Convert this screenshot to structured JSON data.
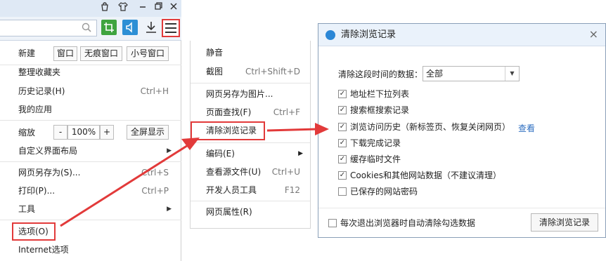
{
  "titlebar": {
    "icons": [
      "bag-icon",
      "shirt-icon",
      "minimize-icon",
      "restore-icon",
      "close-icon"
    ]
  },
  "toolbar": {
    "menu_icon": "hamburger-menu-icon"
  },
  "main_menu": {
    "new_label": "新建",
    "new_buttons": [
      "窗口",
      "无痕窗口",
      "小号窗口"
    ],
    "items_a": [
      {
        "label": "整理收藏夹",
        "shortcut": ""
      },
      {
        "label": "历史记录(H)",
        "shortcut": "Ctrl+H"
      },
      {
        "label": "我的应用",
        "shortcut": ""
      }
    ],
    "zoom_label": "缩放",
    "zoom_minus": "-",
    "zoom_value": "100%",
    "zoom_plus": "+",
    "fullscreen_label": "全屏显示",
    "custom_layout": "自定义界面布局",
    "items_b": [
      {
        "label": "网页另存为(S)...",
        "shortcut": "Ctrl+S"
      },
      {
        "label": "打印(P)...",
        "shortcut": "Ctrl+P"
      },
      {
        "label": "工具",
        "shortcut": ""
      }
    ],
    "options_label": "选项(O)",
    "internet_options": "Internet选项"
  },
  "sub_menu": {
    "mute": "静音",
    "screenshot": "截图",
    "screenshot_sc": "Ctrl+Shift+D",
    "save_as_image": "网页另存为图片...",
    "find": "页面查找(F)",
    "find_sc": "Ctrl+F",
    "clear_history": "清除浏览记录",
    "encoding": "编码(E)",
    "view_source": "查看源文件(U)",
    "view_source_sc": "Ctrl+U",
    "dev_tools": "开发人员工具",
    "dev_tools_sc": "F12",
    "page_props": "网页属性(R)"
  },
  "dialog": {
    "title": "清除浏览记录",
    "close": "×",
    "range_label": "清除这段时间的数据：",
    "range_value": "全部",
    "options": [
      {
        "label": "地址栏下拉列表",
        "checked": true
      },
      {
        "label": "搜索框搜索记录",
        "checked": true
      },
      {
        "label": "浏览访问历史（新标签页、恢复关闭网页）",
        "checked": true
      },
      {
        "label": "下载完成记录",
        "checked": true
      },
      {
        "label": "缓存临时文件",
        "checked": true
      },
      {
        "label": "Cookies和其他网站数据（不建议清理）",
        "checked": true
      },
      {
        "label": "已保存的网站密码",
        "checked": false
      }
    ],
    "view_link": "查看",
    "auto_clear_label": "每次退出浏览器时自动清除勾选数据",
    "clear_button": "清除浏览记录"
  },
  "colors": {
    "highlight": "#e23a3a",
    "link": "#2f6fc1"
  }
}
